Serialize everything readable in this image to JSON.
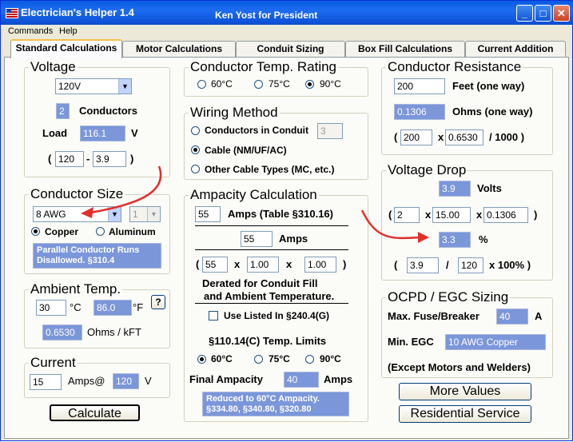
{
  "window": {
    "title": "Electrician's Helper 1.4",
    "subtitle": "Ken Yost for President",
    "minimize": "_",
    "maximize": "□",
    "close": "✕"
  },
  "menu": [
    "Commands",
    "Help"
  ],
  "tabs": [
    "Standard Calculations",
    "Motor Calculations",
    "Conduit Sizing",
    "Box Fill Calculations",
    "Current Addition"
  ],
  "voltage": {
    "title": "Voltage",
    "selected": "120V",
    "conductors_value": "2",
    "conductors_label": "Conductors",
    "load_label": "Load",
    "load_value": "116.1",
    "load_unit": "V",
    "paren_open": "(",
    "a": "120",
    "minus": "-",
    "b": "3.9",
    "paren_close": ")"
  },
  "conductor_size": {
    "title": "Conductor Size",
    "selected": "8 AWG",
    "parallel_selected": "1",
    "copper": "Copper",
    "aluminum": "Aluminum",
    "note": "Parallel Conductor Runs Disallowed.     §310.4"
  },
  "ambient": {
    "title": "Ambient Temp.",
    "celsius": "30",
    "c_unit": "°C",
    "fahrenheit": "86.0",
    "f_unit": "°F",
    "help": "?",
    "ohms_value": "0.6530",
    "ohms_label": "Ohms / kFT"
  },
  "current": {
    "title": "Current",
    "amps": "15",
    "amps_label": "Amps@",
    "volts": "120",
    "volt_unit": "V"
  },
  "calculate": "Calculate",
  "temp_rating": {
    "title": "Conductor Temp. Rating",
    "options": [
      "60°C",
      "75°C",
      "90°C"
    ]
  },
  "wiring": {
    "title": "Wiring Method",
    "conduit": "Conductors in Conduit",
    "conduit_count": "3",
    "cable": "Cable (NM/UF/AC)",
    "other": "Other Cable Types (MC, etc.)"
  },
  "ampacity": {
    "title": "Ampacity Calculation",
    "table_value": "55",
    "table_label": "Amps (Table §310.16)",
    "amps_value": "55",
    "amps_label": "Amps",
    "open": "(",
    "m1": "55",
    "x1": "x",
    "m2": "1.00",
    "x2": "x",
    "m3": "1.00",
    "close": ")",
    "derated_1": "Derated for Conduit Fill",
    "derated_2": "and Ambient Temperature.",
    "listed": "Use Listed In §240.4(G)",
    "limits_title": "§110.14(C) Temp. Limits",
    "limit_options": [
      "60°C",
      "75°C",
      "90°C"
    ],
    "final_label": "Final Ampacity",
    "final_value": "40",
    "final_unit": "Amps",
    "note": "Reduced to 60°C Ampacity.  §334.80,  §340.80,  §320.80"
  },
  "resistance": {
    "title": "Conductor Resistance",
    "feet": "200",
    "feet_label": "Feet  (one way)",
    "ohms": "0.1306",
    "ohms_label": "Ohms  (one way)",
    "open": "(",
    "r1": "200",
    "x": "x",
    "r2": "0.6530",
    "tail": "/ 1000 )"
  },
  "voltage_drop": {
    "title": "Voltage Drop",
    "volts": "3.9",
    "volts_label": "Volts",
    "open": "(",
    "d1": "2",
    "x1": "x",
    "d2": "15.00",
    "x2": "x",
    "d3": "0.1306",
    "close": ")",
    "pct": "3.3",
    "pct_label": "%",
    "open2": "(",
    "p1": "3.9",
    "slash": "/",
    "p2": "120",
    "tail": "x 100% )"
  },
  "ocpd": {
    "title": "OCPD / EGC Sizing",
    "fuse_label": "Max. Fuse/Breaker",
    "fuse_value": "40",
    "fuse_unit": "A",
    "egc_label": "Min. EGC",
    "egc_value": "10 AWG Copper",
    "note": "(Except Motors and Welders)"
  },
  "more_values": "More Values",
  "residential": "Residential Service",
  "colors": {
    "titlebar": "#0a5ae0",
    "output_box": "#7b96d9",
    "arrow": "#e0302a"
  }
}
